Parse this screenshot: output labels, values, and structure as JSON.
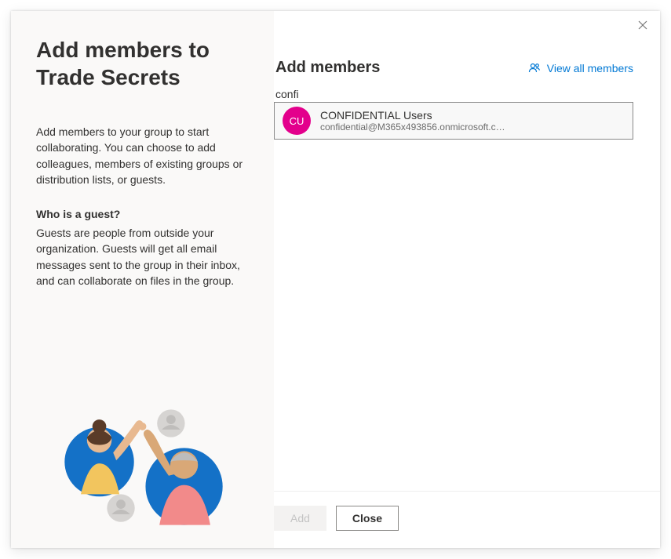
{
  "left": {
    "title": "Add members to Trade Secrets",
    "description": "Add members to your group to start collaborating. You can choose to add colleagues, members of existing groups or distribution lists, or guests.",
    "subheading": "Who is a guest?",
    "subdescription": "Guests are people from outside your organization. Guests will get all email messages sent to the group in their inbox, and can collaborate on files in the group."
  },
  "right": {
    "heading": "Add members",
    "view_all_label": "View all members",
    "search_value": "confi",
    "suggestion": {
      "initials": "CU",
      "name": "CONFIDENTIAL Users",
      "email": "confidential@M365x493856.onmicrosoft.c…"
    }
  },
  "footer": {
    "add_label": "Add",
    "close_label": "Close"
  }
}
